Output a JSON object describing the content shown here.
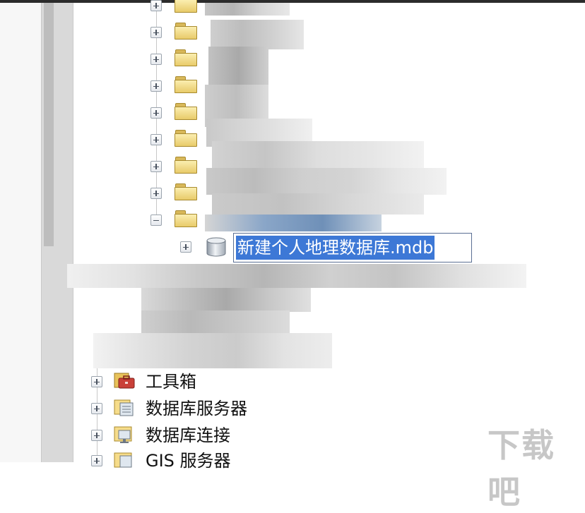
{
  "tree": {
    "rename_value": "新建个人地理数据库.mdb",
    "bottom_items": [
      {
        "label": "工具箱",
        "icon": "toolbox-icon"
      },
      {
        "label": "数据库服务器",
        "icon": "database-server-icon"
      },
      {
        "label": "数据库连接",
        "icon": "database-connection-icon"
      },
      {
        "label": "GIS 服务器",
        "icon": "gis-server-icon"
      }
    ]
  },
  "watermark": {
    "text": "下载吧"
  },
  "colors": {
    "selection": "#3d78d6",
    "folder": "#e8cb6a",
    "scrollbar": "#d9d9d9"
  }
}
